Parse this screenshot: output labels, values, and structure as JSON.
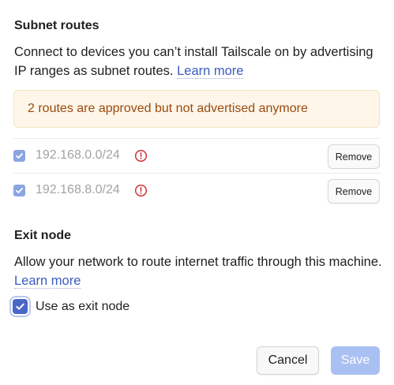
{
  "subnet": {
    "title": "Subnet routes",
    "description": "Connect to devices you can’t install Tailscale on by advertising IP ranges as subnet routes.",
    "learn_more": "Learn more",
    "warning": "2 routes are approved but not advertised anymore",
    "routes": [
      {
        "ip": "192.168.0.0/24",
        "checked": true,
        "remove_label": "Remove"
      },
      {
        "ip": "192.168.8.0/24",
        "checked": true,
        "remove_label": "Remove"
      }
    ]
  },
  "exit_node": {
    "title": "Exit node",
    "description": "Allow your network to route internet traffic through this machine.",
    "learn_more": "Learn more",
    "checkbox_label": "Use as exit node",
    "checked": true
  },
  "footer": {
    "cancel_label": "Cancel",
    "save_label": "Save"
  },
  "colors": {
    "accent": "#4967c6",
    "link": "#3b5bc0",
    "warning_bg": "#fdf6e9",
    "warning_text": "#9a4a10",
    "alert_icon": "#d0343a",
    "save_disabled": "#a9c0f3"
  },
  "icons": {
    "route_checkbox": "checkmark-icon",
    "route_alert": "alert-circle-icon",
    "exit_checkbox": "checkmark-icon"
  }
}
